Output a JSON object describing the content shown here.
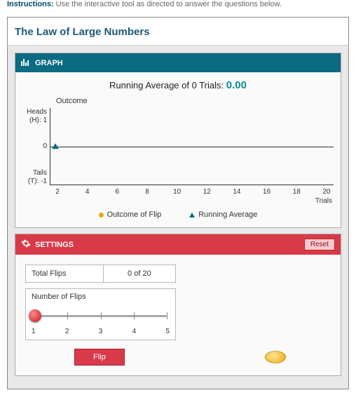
{
  "instructions": {
    "label": "Instructions:",
    "text": "Use the interactive tool as directed to answer the questions below."
  },
  "title": "The Law of Large Numbers",
  "graph": {
    "header": "GRAPH",
    "running_prefix": "Running Average of 0 Trials:",
    "running_value": "0.00",
    "outcome_label": "Outcome",
    "y_ticks": {
      "top": "Heads (H): 1",
      "mid": "0",
      "bot": "Tails (T): -1"
    },
    "x_ticks": [
      "2",
      "4",
      "6",
      "8",
      "10",
      "12",
      "14",
      "16",
      "18",
      "20"
    ],
    "x_label": "Trials",
    "legend": {
      "outcome": "Outcome of Flip",
      "avg": "Running Average"
    }
  },
  "settings": {
    "header": "SETTINGS",
    "reset": "Reset",
    "total_flips_label": "Total Flips",
    "total_flips_value": "0 of 20",
    "num_flips_label": "Number of Flips",
    "slider_labels": [
      "1",
      "2",
      "3",
      "4",
      "5"
    ],
    "flip": "Flip"
  },
  "chart_data": {
    "type": "line",
    "title": "Running Average of 0 Trials: 0.00",
    "xlabel": "Trials",
    "ylabel": "Outcome",
    "xlim": [
      0,
      20
    ],
    "ylim": [
      -1,
      1
    ],
    "x_ticks": [
      2,
      4,
      6,
      8,
      10,
      12,
      14,
      16,
      18,
      20
    ],
    "y_ticks": [
      {
        "value": 1,
        "label": "Heads (H): 1"
      },
      {
        "value": 0,
        "label": "0"
      },
      {
        "value": -1,
        "label": "Tails (T): -1"
      }
    ],
    "series": [
      {
        "name": "Outcome of Flip",
        "marker": "circle",
        "color": "#e6a817",
        "x": [],
        "y": []
      },
      {
        "name": "Running Average",
        "marker": "triangle",
        "color": "#0a6b82",
        "x": [
          0
        ],
        "y": [
          0
        ]
      }
    ]
  }
}
